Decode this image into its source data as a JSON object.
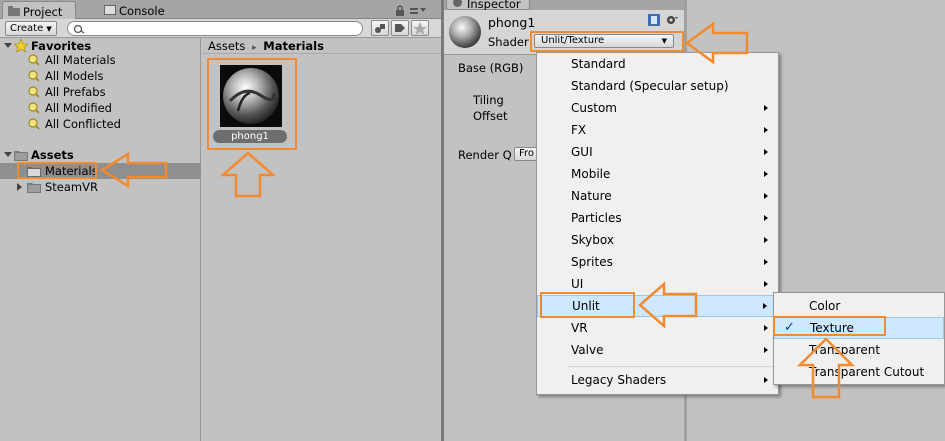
{
  "project": {
    "tab_project": "Project",
    "tab_console": "Console",
    "create_label": "Create",
    "favorites_label": "Favorites",
    "favorites": [
      "All Materials",
      "All Models",
      "All Prefabs",
      "All Modified",
      "All Conflicted"
    ],
    "assets_label": "Assets",
    "folders": [
      "Materials",
      "SteamVR"
    ],
    "breadcrumb_root": "Assets",
    "breadcrumb_sep": "▸",
    "breadcrumb_current": "Materials",
    "asset_name": "phong1"
  },
  "inspector": {
    "tab_label": "Inspector",
    "material_name": "phong1",
    "shader_label": "Shader",
    "shader_value": "Unlit/Texture",
    "base_label": "Base (RGB)",
    "tiling_label": "Tiling",
    "offset_label": "Offset",
    "render_queue_label": "Render Q",
    "render_queue_value": "Fro"
  },
  "shader_menu": {
    "items": [
      "Standard",
      "Standard (Specular setup)",
      "Custom",
      "FX",
      "GUI",
      "Mobile",
      "Nature",
      "Particles",
      "Skybox",
      "Sprites",
      "UI",
      "Unlit",
      "VR",
      "Valve"
    ],
    "legacy": "Legacy Shaders",
    "submenu": [
      "Color",
      "Texture",
      "Transparent",
      "Transparent Cutout"
    ],
    "checkmark": "✓"
  },
  "colors": {
    "highlight": "#f28a2e",
    "menu_hover": "#cde8ff"
  }
}
